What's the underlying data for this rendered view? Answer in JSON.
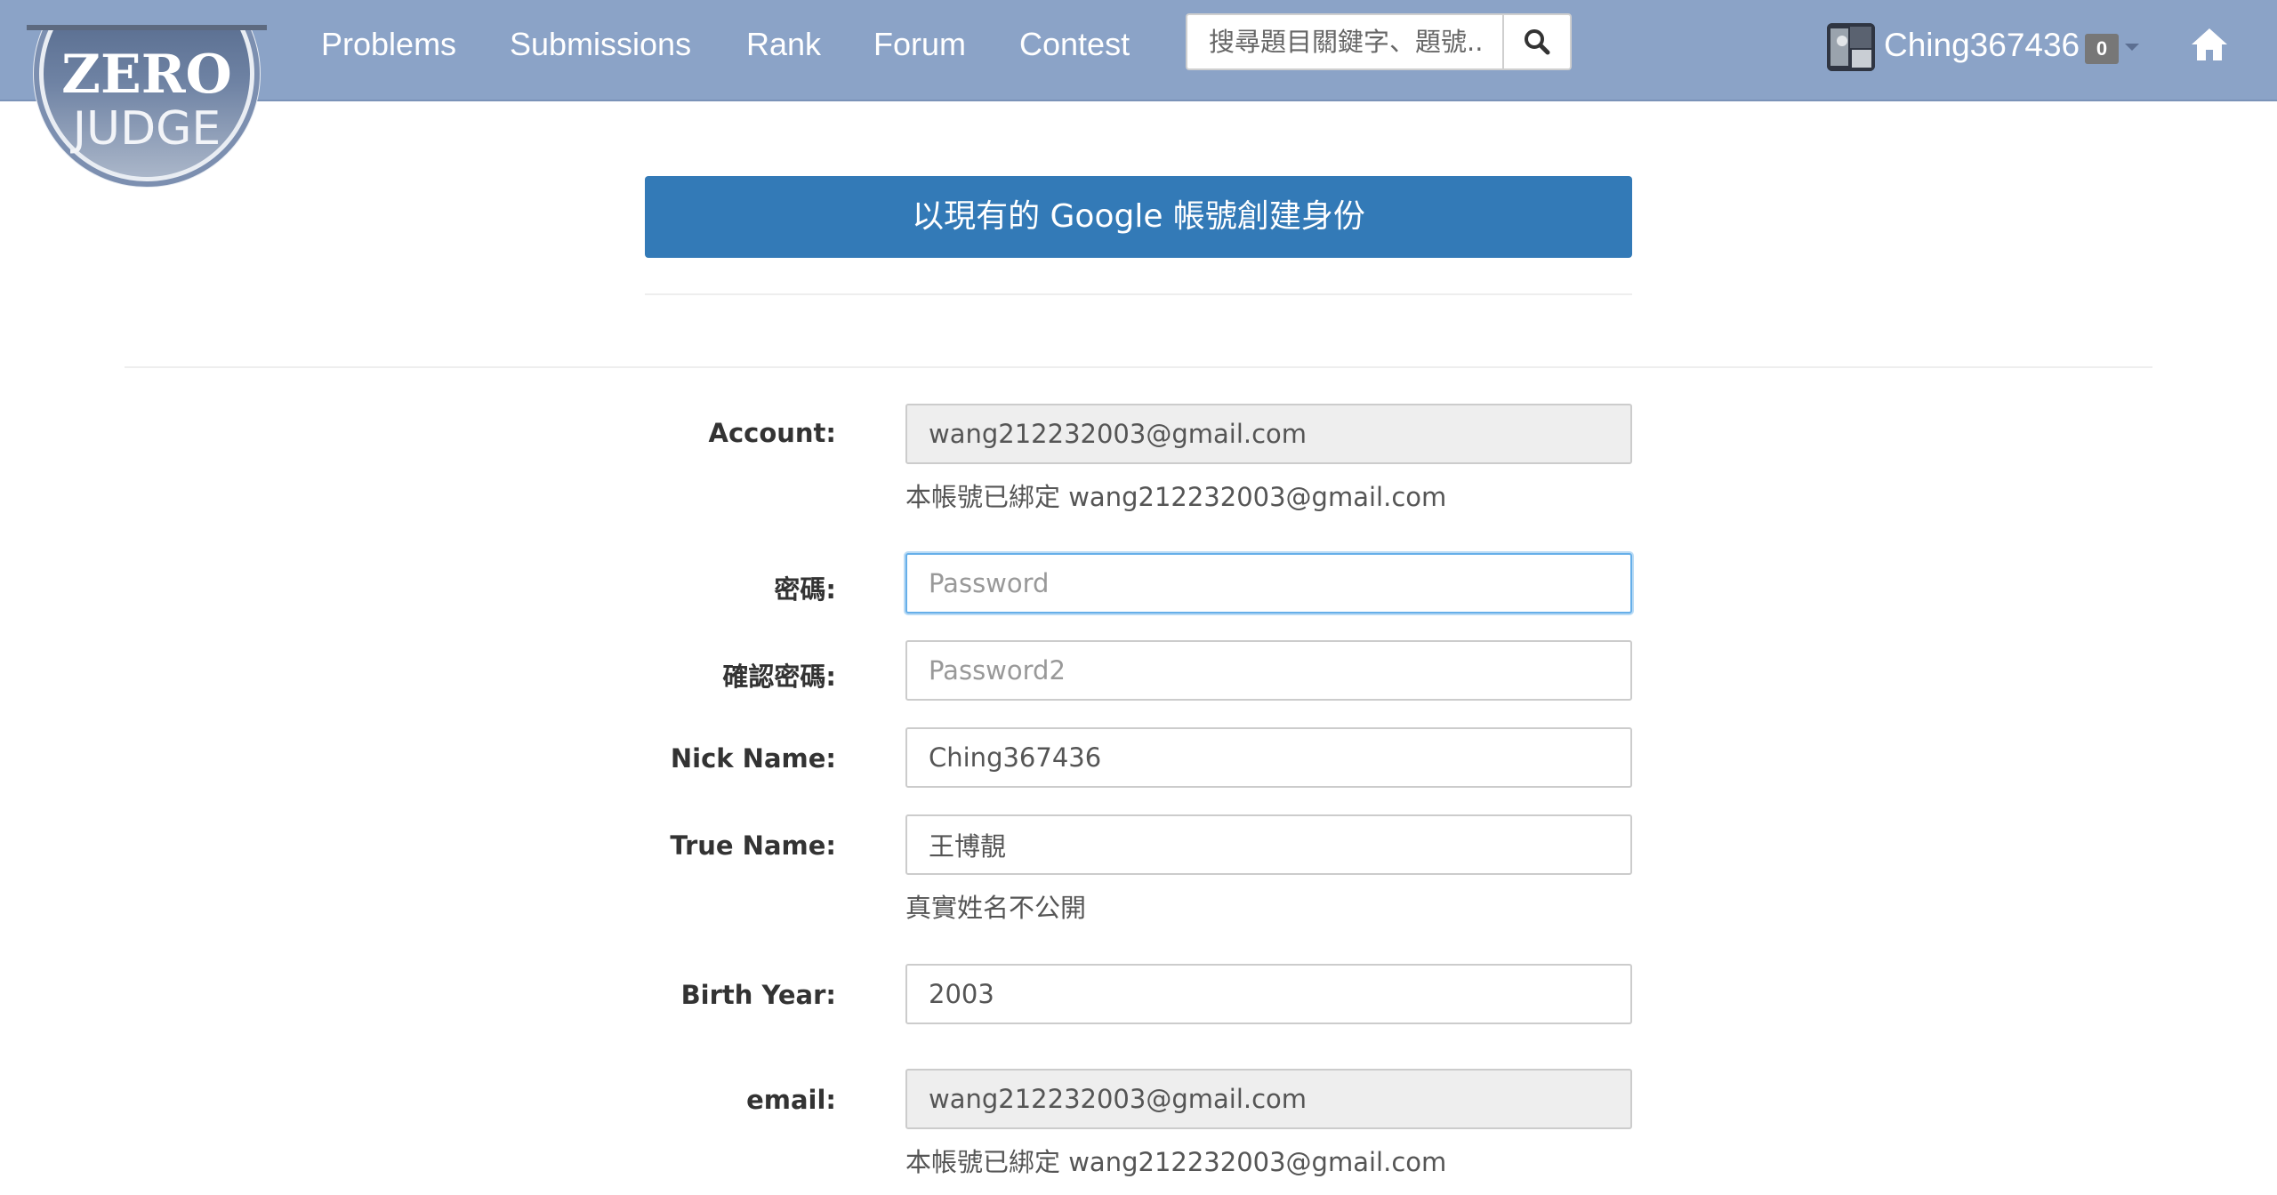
{
  "brand": {
    "line1": "ZERO",
    "line2": "JUDGE"
  },
  "nav": {
    "items": [
      {
        "label": "Problems"
      },
      {
        "label": "Submissions"
      },
      {
        "label": "Rank"
      },
      {
        "label": "Forum"
      },
      {
        "label": "Contest"
      }
    ],
    "search_placeholder": "搜尋題目關鍵字、題號...",
    "username": "Ching367436",
    "notification_count": "0"
  },
  "banner": {
    "label": "以現有的 Google 帳號創建身份"
  },
  "form": {
    "account": {
      "label": "Account:",
      "value": "wang212232003@gmail.com",
      "help": "本帳號已綁定 wang212232003@gmail.com"
    },
    "password": {
      "label": "密碼:",
      "placeholder": "Password"
    },
    "password2": {
      "label": "確認密碼:",
      "placeholder": "Password2"
    },
    "nickname": {
      "label": "Nick Name:",
      "value": "Ching367436"
    },
    "truename": {
      "label": "True Name:",
      "value": "王博靚",
      "help": "真實姓名不公開"
    },
    "birthyear": {
      "label": "Birth Year:",
      "value": "2003"
    },
    "email": {
      "label": "email:",
      "value": "wang212232003@gmail.com",
      "help": "本帳號已綁定 wang212232003@gmail.com"
    }
  },
  "colors": {
    "navbar": "#8ba3c7",
    "banner": "#337ab7",
    "readonly_bg": "#eeeeee",
    "focus": "#66afe9"
  },
  "icons": {
    "search": "search-icon",
    "home": "home-icon",
    "dropdown": "caret-down-icon"
  }
}
